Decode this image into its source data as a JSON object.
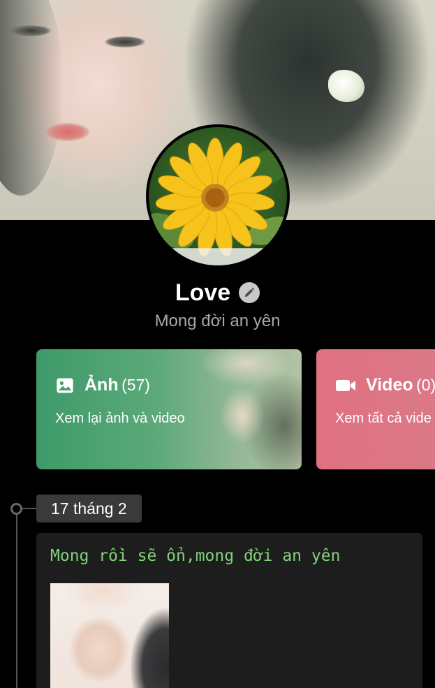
{
  "profile": {
    "name": "Love",
    "bio": "Mong đời an yên"
  },
  "cards": {
    "photos": {
      "label": "Ảnh",
      "count": "(57)",
      "subtitle": "Xem lại ảnh và video",
      "color": "#3e9a69"
    },
    "videos": {
      "label": "Video",
      "count": "(0)",
      "subtitle": "Xem tất cả vide",
      "color": "#e07181"
    }
  },
  "timeline": {
    "date": "17 tháng 2",
    "post": {
      "text": "Mong rồi sẽ ổn,mong đời an yên",
      "text_color": "#7fd47a"
    }
  },
  "icons": [
    "edit-pencil-icon",
    "image-icon",
    "video-camera-icon"
  ]
}
